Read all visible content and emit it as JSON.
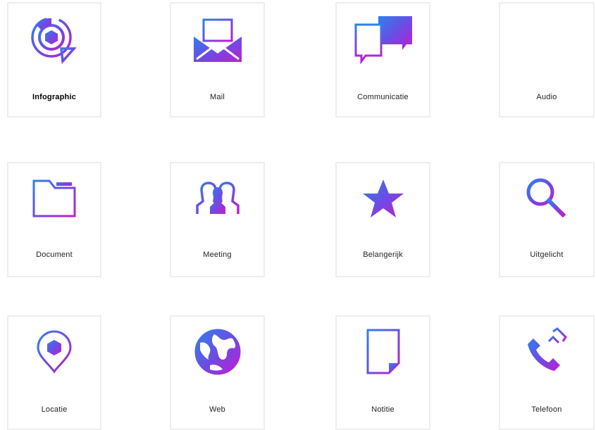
{
  "colors": {
    "gradient_start": "#2f80ed",
    "gradient_mid": "#6a4de4",
    "gradient_end": "#c21bd2",
    "tile_border": "#eeeeee"
  },
  "tiles": [
    {
      "label": "Infographic",
      "icon": "infographic-icon",
      "active": true
    },
    {
      "label": "Mail",
      "icon": "mail-icon"
    },
    {
      "label": "Communicatie",
      "icon": "chat-icon"
    },
    {
      "label": "Audio",
      "icon": "audio-wave-icon"
    },
    {
      "label": "Document",
      "icon": "folder-icon"
    },
    {
      "label": "Meeting",
      "icon": "people-icon"
    },
    {
      "label": "Belangerijk",
      "icon": "star-icon"
    },
    {
      "label": "Uitgelicht",
      "icon": "magnifier-icon"
    },
    {
      "label": "Locatie",
      "icon": "location-pin-icon"
    },
    {
      "label": "Web",
      "icon": "globe-icon"
    },
    {
      "label": "Notitie",
      "icon": "note-icon"
    },
    {
      "label": "Telefoon",
      "icon": "phone-icon"
    }
  ]
}
